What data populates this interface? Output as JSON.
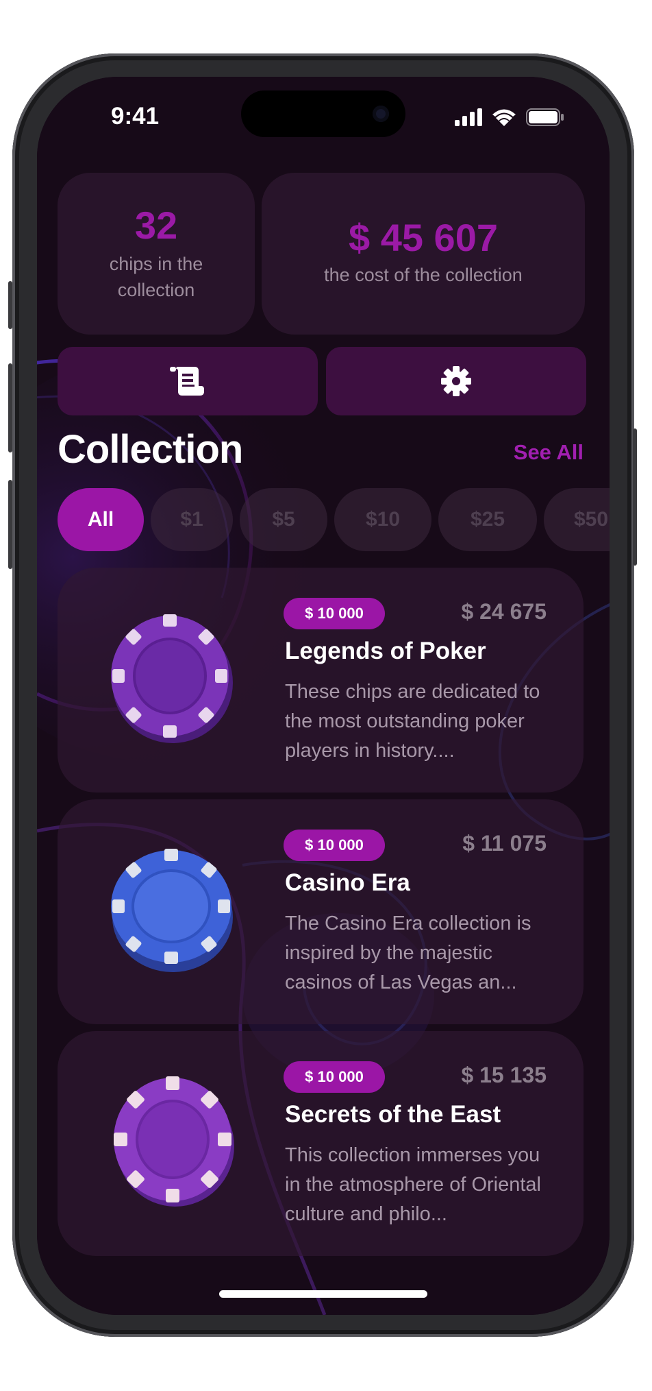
{
  "status_bar": {
    "time": "9:41"
  },
  "stats": {
    "chips_count": "32",
    "chips_label": "chips in the collection",
    "cost_value": "$ 45 607",
    "cost_label": "the cost of the collection"
  },
  "actions": {
    "list_icon": "scroll-list-icon",
    "settings_icon": "gear-icon"
  },
  "section": {
    "title": "Collection",
    "see_all": "See All"
  },
  "filters": [
    {
      "label": "All",
      "active": true
    },
    {
      "label": "$1",
      "active": false
    },
    {
      "label": "$5",
      "active": false
    },
    {
      "label": "$10",
      "active": false
    },
    {
      "label": "$25",
      "active": false
    },
    {
      "label": "$50",
      "active": false
    }
  ],
  "items": [
    {
      "badge": "$ 10 000",
      "price": "$ 24 675",
      "title": "Legends of Poker",
      "description": "These chips are dedicated to the most outstanding poker players in history....",
      "chip_color": "#7b34b8"
    },
    {
      "badge": "$ 10 000",
      "price": "$ 11 075",
      "title": "Casino Era",
      "description": "The Casino Era collection is inspired by the majestic casinos of Las Vegas an...",
      "chip_color": "#3e62d8"
    },
    {
      "badge": "$ 10 000",
      "price": "$ 15 135",
      "title": "Secrets of the East",
      "description": "This collection immerses you in the atmosphere of Oriental culture and philo...",
      "chip_color": "#8a3cc4"
    }
  ],
  "colors": {
    "accent": "#9b16a6",
    "background": "#170a18"
  }
}
